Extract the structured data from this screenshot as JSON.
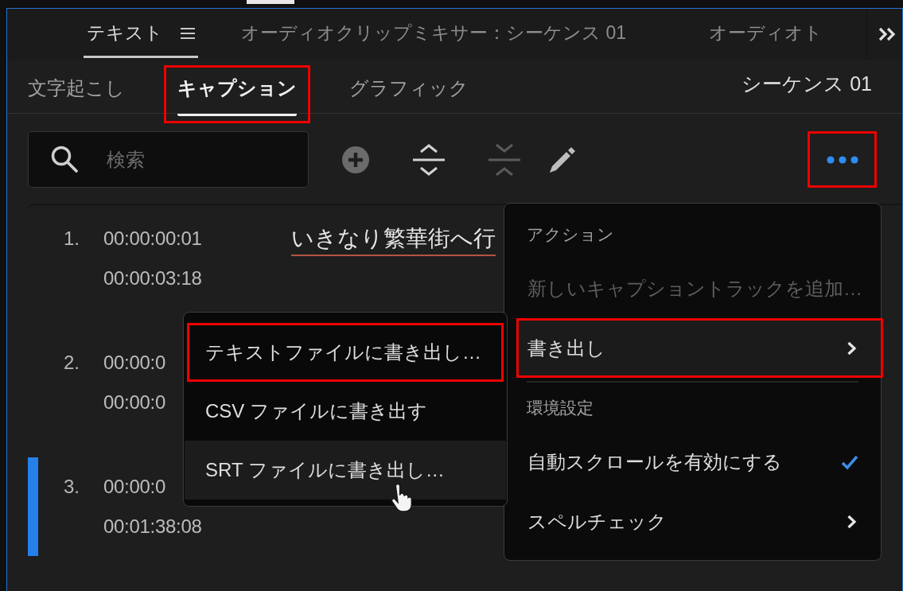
{
  "panel_tabs": [
    {
      "label": "テキスト",
      "selected": true
    },
    {
      "label": "オーディオクリップミキサー：シーケンス 01",
      "selected": false
    },
    {
      "label": "オーディオト",
      "selected": false
    }
  ],
  "caption_tabs": [
    {
      "label": "文字起こし",
      "selected": false,
      "annotated": false
    },
    {
      "label": "キャプション",
      "selected": true,
      "annotated": true
    },
    {
      "label": "グラフィック",
      "selected": false,
      "annotated": false
    }
  ],
  "sequence": "シーケンス 01",
  "search": {
    "placeholder": "検索"
  },
  "tools": [
    {
      "kind": "add",
      "disabled": false
    },
    {
      "kind": "split",
      "disabled": false
    },
    {
      "kind": "merge",
      "disabled": true
    },
    {
      "kind": "edit",
      "disabled": false
    }
  ],
  "more_button": {
    "annotated": true
  },
  "captions": [
    {
      "number": "1.",
      "start": "00:00:00:01",
      "end": "00:00:03:18",
      "text": "いきなり繁華街へ行",
      "spell_error": true,
      "selected": false
    },
    {
      "number": "2.",
      "start": "00:00:0",
      "end": "00:00:0",
      "selected": false
    },
    {
      "number": "3.",
      "start": "00:00:0",
      "end": "00:01:38:08",
      "selected": true
    }
  ],
  "menu": {
    "sections": [
      {
        "title": "アクション",
        "items": [
          {
            "label": "新しいキャプショントラックを追加…",
            "disabled": true,
            "submenu": false,
            "checked": false,
            "selected": false,
            "annotated": false
          },
          {
            "label": "書き出し",
            "disabled": false,
            "submenu": true,
            "checked": false,
            "selected": true,
            "annotated": true
          }
        ]
      },
      {
        "title": "環境設定",
        "items": [
          {
            "label": "自動スクロールを有効にする",
            "disabled": false,
            "submenu": false,
            "checked": true,
            "selected": false,
            "annotated": false
          },
          {
            "label": "スペルチェック",
            "disabled": false,
            "submenu": true,
            "checked": false,
            "selected": false,
            "annotated": false
          }
        ]
      }
    ]
  },
  "export_submenu": {
    "items": [
      {
        "label": "テキストファイルに書き出し…",
        "selected": false,
        "annotated": true
      },
      {
        "label": "CSV ファイルに書き出す",
        "selected": false,
        "annotated": false
      },
      {
        "label": "SRT ファイルに書き出し…",
        "selected": true,
        "annotated": false
      }
    ]
  }
}
